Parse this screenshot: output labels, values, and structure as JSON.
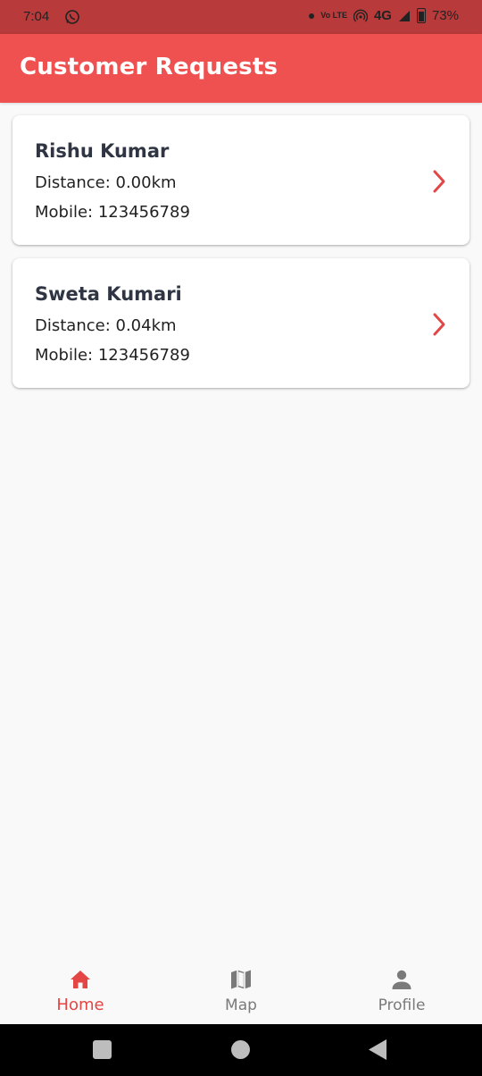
{
  "status_bar": {
    "time": "7:04",
    "network": "4G",
    "lte_label": "Vo LTE",
    "battery": "73%",
    "icons": [
      "whatsapp-icon",
      "dot-icon",
      "volte-icon",
      "hotspot-icon",
      "signal-icon",
      "battery-icon"
    ]
  },
  "app_bar": {
    "title": "Customer Requests",
    "color": "#ef5050"
  },
  "requests": [
    {
      "name": "Rishu Kumar",
      "distance": "Distance: 0.00km",
      "mobile": "Mobile: 123456789"
    },
    {
      "name": "Sweta Kumari",
      "distance": "Distance: 0.04km",
      "mobile": "Mobile: 123456789"
    }
  ],
  "bottom_nav": {
    "items": [
      {
        "label": "Home",
        "icon": "home-icon",
        "active": true
      },
      {
        "label": "Map",
        "icon": "map-icon",
        "active": false
      },
      {
        "label": "Profile",
        "icon": "person-icon",
        "active": false
      }
    ],
    "active_color": "#e44545",
    "inactive_color": "#7a7a7a"
  },
  "system_nav": {
    "buttons": [
      "recents-button",
      "home-button",
      "back-button"
    ]
  }
}
